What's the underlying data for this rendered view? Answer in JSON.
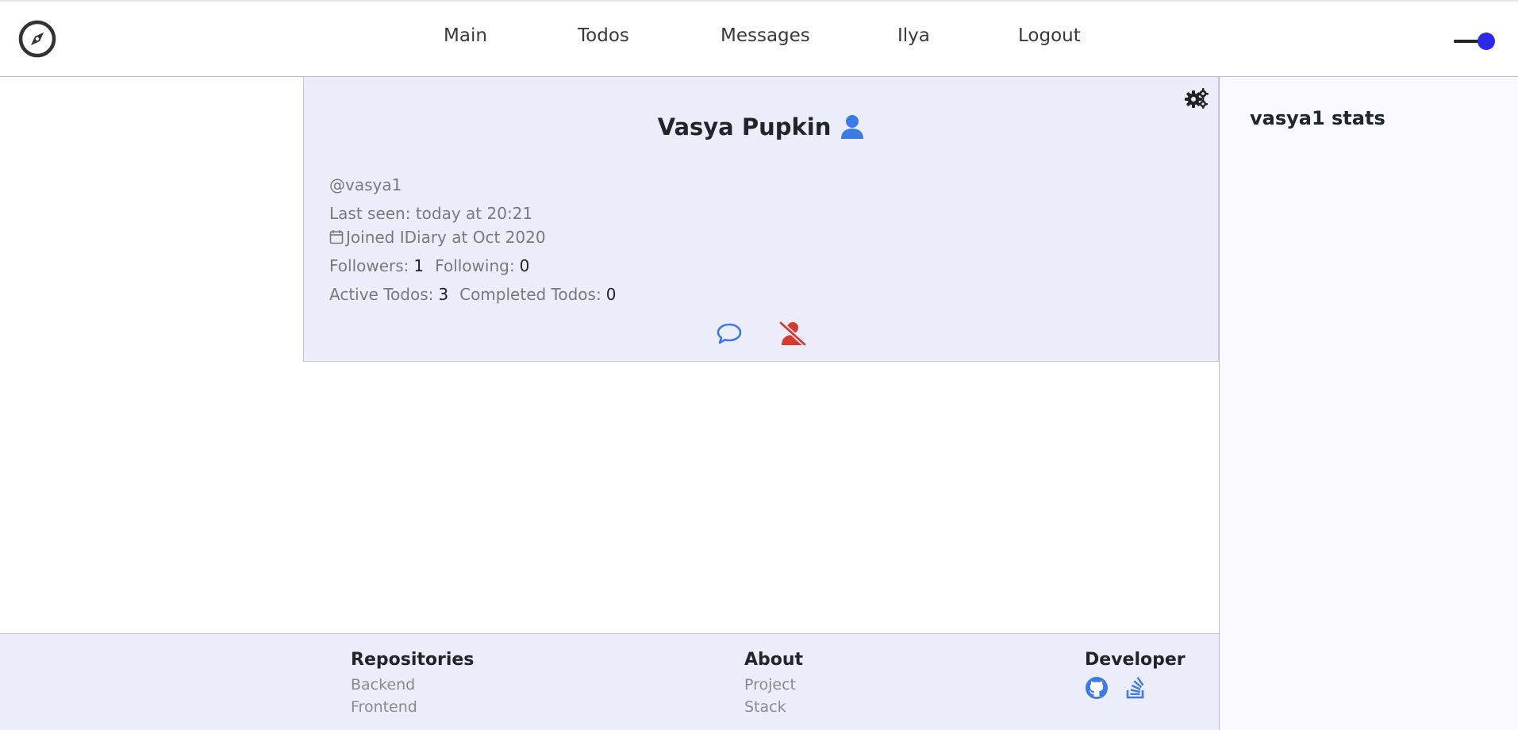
{
  "header": {
    "logo_icon": "compass-icon",
    "nav": [
      {
        "label": "Main"
      },
      {
        "label": "Todos"
      },
      {
        "label": "Messages"
      },
      {
        "label": "Ilya"
      },
      {
        "label": "Logout"
      }
    ],
    "theme_toggle_icon": "toggle-switch-icon"
  },
  "profile": {
    "name": "Vasya Pupkin",
    "username": "@vasya1",
    "last_seen": "Last seen: today at 20:21",
    "joined": "Joined IDiary at Oct 2020",
    "followers_label": "Followers:",
    "followers_value": "1",
    "following_label": "Following:",
    "following_value": "0",
    "active_todos_label": "Active Todos:",
    "active_todos_value": "3",
    "completed_todos_label": "Completed Todos:",
    "completed_todos_value": "0",
    "settings_icon": "gears-icon",
    "user_icon": "user-icon",
    "message_icon": "chat-bubble-icon",
    "unfollow_icon": "user-slash-icon"
  },
  "side": {
    "title": "vasya1 stats"
  },
  "footer": {
    "repositories": {
      "title": "Repositories",
      "links": [
        "Backend",
        "Frontend"
      ]
    },
    "about": {
      "title": "About",
      "links": [
        "Project",
        "Stack"
      ]
    },
    "developer": {
      "title": "Developer",
      "icons": [
        "github-icon",
        "stackoverflow-icon"
      ]
    }
  },
  "colors": {
    "accent_blue": "#3b7be8",
    "danger_red": "#d63a2f",
    "card_bg": "#ececfb",
    "toggle_knob": "#2a2ae8"
  }
}
